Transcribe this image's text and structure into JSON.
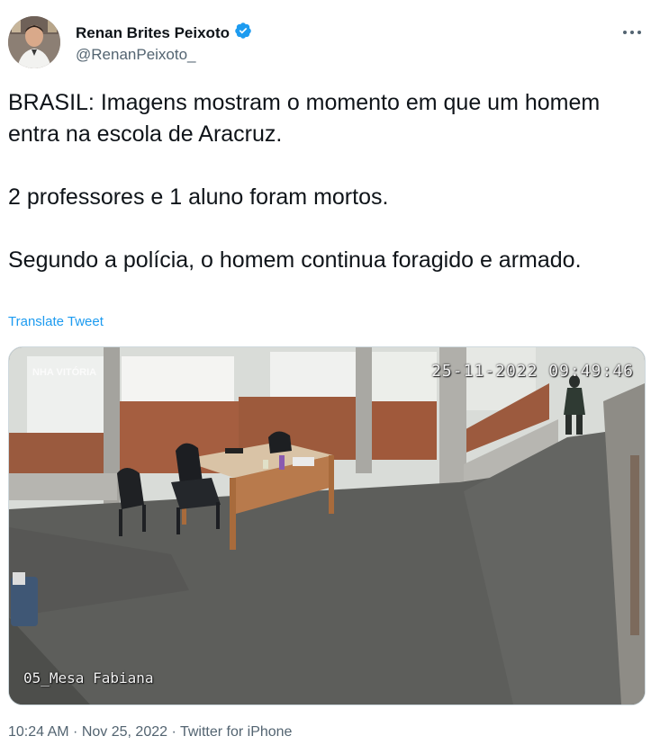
{
  "author": {
    "name": "Renan Brites Peixoto",
    "handle": "@RenanPeixoto_",
    "verified": true,
    "verified_color": "#1d9bf0"
  },
  "tweet": {
    "paragraphs": [
      "BRASIL: Imagens mostram o momento em que um homem entra na escola de Aracruz.",
      "2 professores e 1 aluno foram mortos.",
      "Segundo a polícia, o homem continua foragido e armado."
    ],
    "translate_label": "Translate Tweet"
  },
  "media": {
    "timestamp": "25-11-2022 09:49:46",
    "watermark": "NHA VITÓRIA",
    "camera_label": "05_Mesa Fabiana"
  },
  "meta": {
    "time": "10:24 AM",
    "separator": " · ",
    "date": "Nov 25, 2022",
    "source": "Twitter for iPhone"
  },
  "icons": {
    "more": "more-icon",
    "verified": "verified-badge-icon"
  }
}
